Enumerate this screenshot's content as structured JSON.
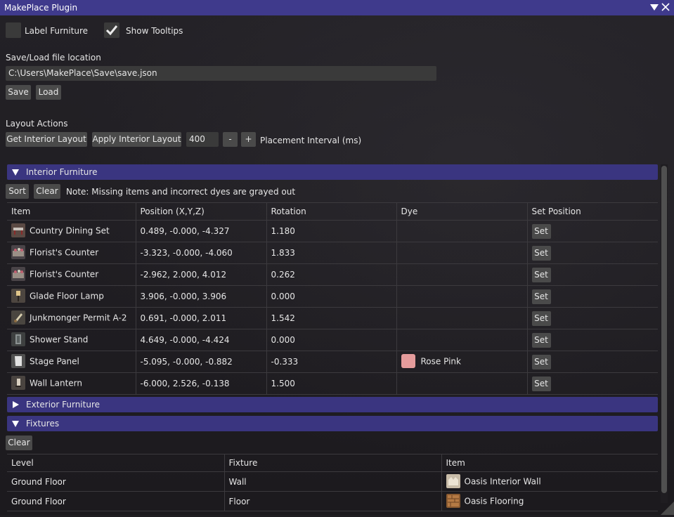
{
  "window": {
    "title": "MakePlace Plugin"
  },
  "options": {
    "label_furniture": "Label Furniture",
    "label_furniture_checked": false,
    "show_tooltips": "Show Tooltips",
    "show_tooltips_checked": true
  },
  "file": {
    "section_label": "Save/Load file location",
    "path": "C:\\Users\\MakePlace\\Save\\save.json",
    "save_label": "Save",
    "load_label": "Load"
  },
  "layout_actions": {
    "section_label": "Layout Actions",
    "get_label": "Get Interior Layout",
    "apply_label": "Apply Interior Layout",
    "interval_value": "400",
    "minus_label": "-",
    "plus_label": "+",
    "interval_label": "Placement Interval (ms)"
  },
  "interior": {
    "header": "Interior Furniture",
    "expanded": true,
    "sort_label": "Sort",
    "clear_label": "Clear",
    "note": "Note: Missing items and incorrect dyes are grayed out",
    "columns": [
      "Item",
      "Position (X,Y,Z)",
      "Rotation",
      "Dye",
      "Set Position"
    ],
    "set_label": "Set",
    "rows": [
      {
        "icon": "dining-set-icon",
        "name": "Country Dining Set",
        "position": "0.489, -0.000, -4.327",
        "rotation": "1.180",
        "dye": "",
        "dye_color": ""
      },
      {
        "icon": "florist-counter-icon",
        "name": "Florist's Counter",
        "position": "-3.323, -0.000, -4.060",
        "rotation": "1.833",
        "dye": "",
        "dye_color": ""
      },
      {
        "icon": "florist-counter-icon",
        "name": "Florist's Counter",
        "position": "-2.962, 2.000, 4.012",
        "rotation": "0.262",
        "dye": "",
        "dye_color": ""
      },
      {
        "icon": "floor-lamp-icon",
        "name": "Glade Floor Lamp",
        "position": "3.906, -0.000, 3.906",
        "rotation": "0.000",
        "dye": "",
        "dye_color": ""
      },
      {
        "icon": "permit-scroll-icon",
        "name": "Junkmonger Permit A-2",
        "position": "0.691, -0.000, 2.011",
        "rotation": "1.542",
        "dye": "",
        "dye_color": ""
      },
      {
        "icon": "shower-stand-icon",
        "name": "Shower Stand",
        "position": "4.649, -0.000, -4.424",
        "rotation": "0.000",
        "dye": "",
        "dye_color": ""
      },
      {
        "icon": "stage-panel-icon",
        "name": "Stage Panel",
        "position": "-5.095, -0.000, -0.882",
        "rotation": "-0.333",
        "dye": "Rose Pink",
        "dye_color": "#e59c9c"
      },
      {
        "icon": "wall-lantern-icon",
        "name": "Wall Lantern",
        "position": "-6.000, 2.526, -0.138",
        "rotation": "1.500",
        "dye": "",
        "dye_color": ""
      }
    ]
  },
  "exterior": {
    "header": "Exterior Furniture",
    "expanded": false
  },
  "fixtures": {
    "header": "Fixtures",
    "expanded": true,
    "clear_label": "Clear",
    "columns": [
      "Level",
      "Fixture",
      "Item"
    ],
    "rows": [
      {
        "level": "Ground Floor",
        "fixture": "Wall",
        "icon": "interior-wall-icon",
        "item": "Oasis Interior Wall"
      },
      {
        "level": "Ground Floor",
        "fixture": "Floor",
        "icon": "flooring-icon",
        "item": "Oasis Flooring"
      }
    ]
  },
  "colors": {
    "titlebar": "#3f3a8c",
    "section_header": "#3a3580",
    "button": "#4a4a4a",
    "background": "#1f1d21"
  }
}
